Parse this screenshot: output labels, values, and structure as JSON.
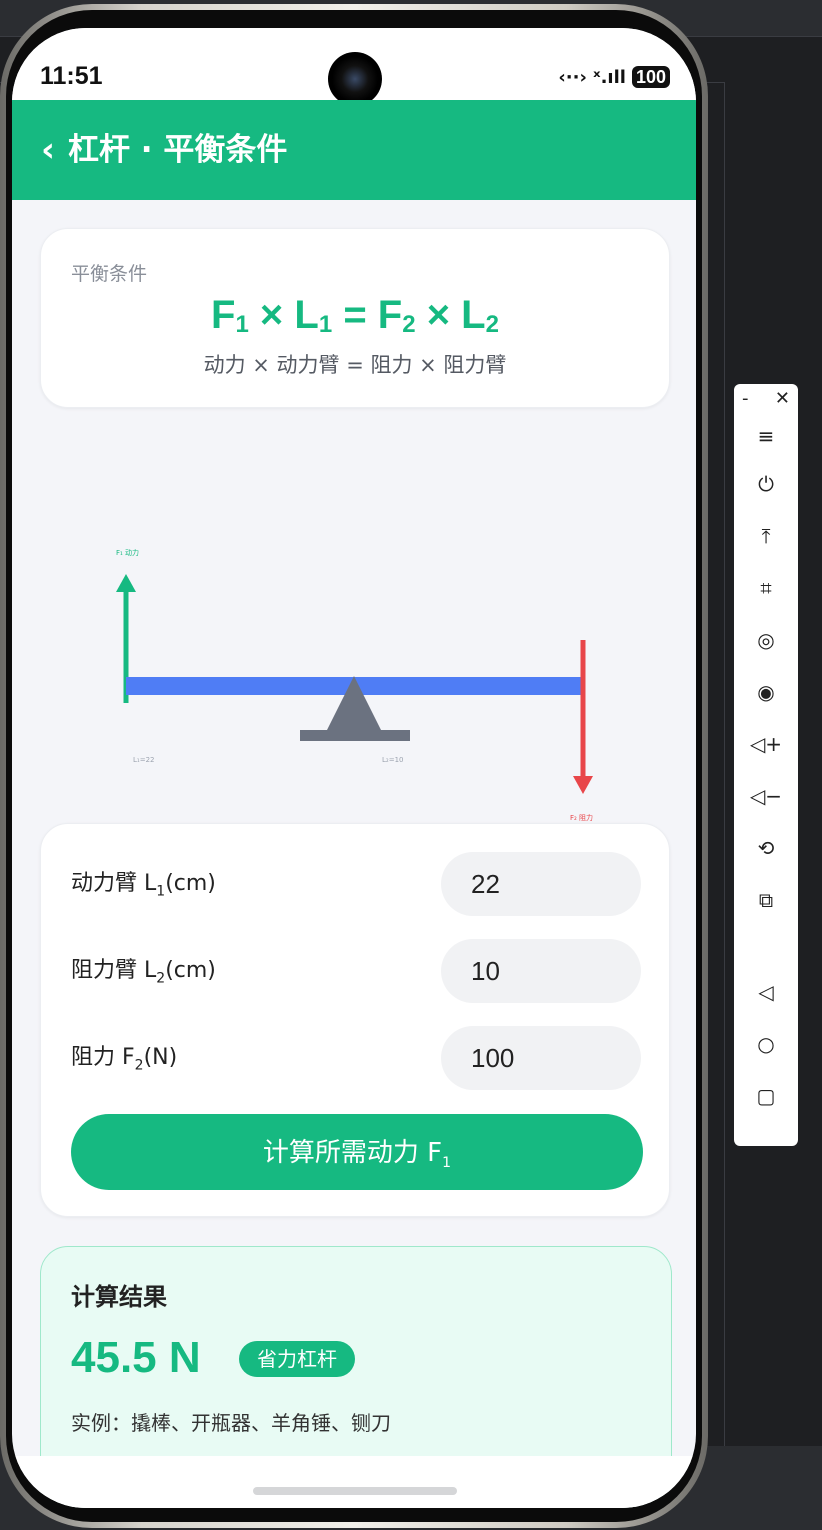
{
  "status_bar": {
    "time": "11:51",
    "icons": "‹··› ˣ.ıll",
    "battery": "100"
  },
  "header": {
    "back_icon": "chevron-left",
    "title": "杠杆 · 平衡条件",
    "color": "#16b981"
  },
  "formula_card": {
    "label": "平衡条件",
    "formula": {
      "f1": "F",
      "s1": "1",
      "times1": " × L",
      "s2": "1",
      "eq": " = F",
      "s3": "2",
      "times2": " × L",
      "s4": "2"
    },
    "description": "动力 × 动力臂 = 阻力 × 阻力臂"
  },
  "diagram": {
    "f1_label": "F₁ 动力",
    "f2_label": "F₂ 阻力",
    "l1_label": "L₁=22",
    "l2_label": "L₂=10",
    "colors": {
      "force1": "#16b981",
      "force2": "#e8464a",
      "lever": "#4f7df5",
      "fulcrum": "#6b7280"
    }
  },
  "form": {
    "l1": {
      "label": "动力臂 L",
      "sub": "1",
      "unit": "(cm)",
      "value": "22"
    },
    "l2": {
      "label": "阻力臂 L",
      "sub": "2",
      "unit": "(cm)",
      "value": "10"
    },
    "f2": {
      "label": "阻力 F",
      "sub": "2",
      "unit": "(N)",
      "value": "100"
    },
    "button": {
      "label": "计算所需动力 F",
      "sub": "1"
    }
  },
  "result": {
    "title": "计算结果",
    "value": "45.5 N",
    "badge": "省力杠杆",
    "example": "实例：撬棒、开瓶器、羊角锤、铡刀"
  },
  "emulator_toolbar": {
    "minimize": "-",
    "close": "✕",
    "buttons": [
      "≡",
      "⏻",
      "⤒",
      "⌗",
      "◎",
      "◉",
      "◁+",
      "◁−",
      "⟲",
      "⧉",
      "◁",
      "○",
      "▢"
    ]
  }
}
